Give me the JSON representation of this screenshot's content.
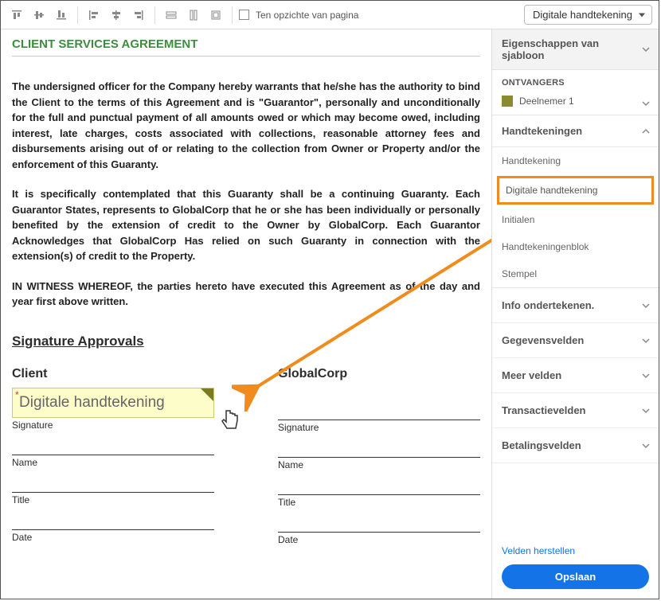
{
  "toolbar": {
    "relative_to_page": "Ten opzichte van pagina",
    "dropdown_selected": "Digitale handtekening"
  },
  "document": {
    "title": "CLIENT SERVICES AGREEMENT",
    "para1": "The undersigned officer for the Company hereby warrants that he/she has the authority to bind the Client to the terms of this Agreement and is \"Guarantor\", personally and unconditionally for the full and punctual payment of all amounts owed or which may become owed, including interest, late charges, costs associated with collections, reasonable attorney fees and disbursements arising out of or relating to the collection from Owner or Property and/or the enforcement of this Guaranty.",
    "para2": "It is specifically contemplated that this Guaranty shall be a continuing Guaranty. Each Guarantor States, represents to GlobalCorp that he or she has been individually or personally benefited by the extension of credit to the Owner by GlobalCorp. Each Guarantor Acknowledges that GlobalCorp Has relied on such Guaranty in connection with the extension(s) of credit to the Property.",
    "para3": "IN WITNESS WHEREOF, the parties hereto have executed this Agreement as of the day and year first above written.",
    "sig_approvals": "Signature Approvals",
    "col1_head": "Client",
    "col2_head": "GlobalCorp",
    "field_label": "Digitale handtekening",
    "labels": {
      "signature": "Signature",
      "name": "Name",
      "title": "Title",
      "date": "Date"
    }
  },
  "panel": {
    "template_props": "Eigenschappen van sjabloon",
    "recipients_head": "ONTVANGERS",
    "recipient1": "Deelnemer 1",
    "signatures_head": "Handtekeningen",
    "fields": {
      "signature": "Handtekening",
      "digital": "Digitale handtekening",
      "initials": "Initialen",
      "sig_block": "Handtekeningenblok",
      "stamp": "Stempel"
    },
    "sections": {
      "info": "Info ondertekenen.",
      "data": "Gegevensvelden",
      "more": "Meer velden",
      "transaction": "Transactievelden",
      "payment": "Betalingsvelden"
    },
    "reset": "Velden herstellen",
    "save": "Opslaan"
  }
}
